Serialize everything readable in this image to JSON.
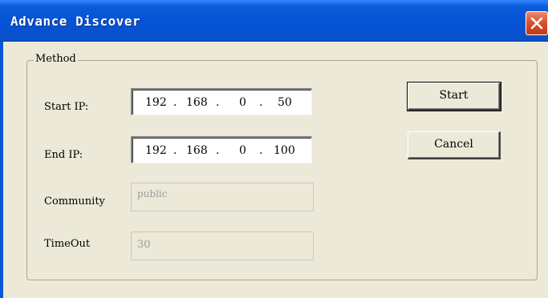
{
  "window": {
    "title": "Advance Discover"
  },
  "group": {
    "legend": "Method"
  },
  "fields": {
    "start_ip": {
      "label": "Start IP:",
      "octets": [
        "192",
        "168",
        "0",
        "50"
      ]
    },
    "end_ip": {
      "label": "End IP:",
      "octets": [
        "192",
        "168",
        "0",
        "100"
      ]
    },
    "community": {
      "label": "Community",
      "value": "public"
    },
    "timeout": {
      "label": "TimeOut",
      "value": "30"
    }
  },
  "buttons": {
    "start": "Start",
    "cancel": "Cancel"
  },
  "icons": {
    "close": "close-icon"
  },
  "colors": {
    "titlebar": "#0553D6",
    "close": "#D95431",
    "dialog_bg": "#ECE9D8"
  }
}
